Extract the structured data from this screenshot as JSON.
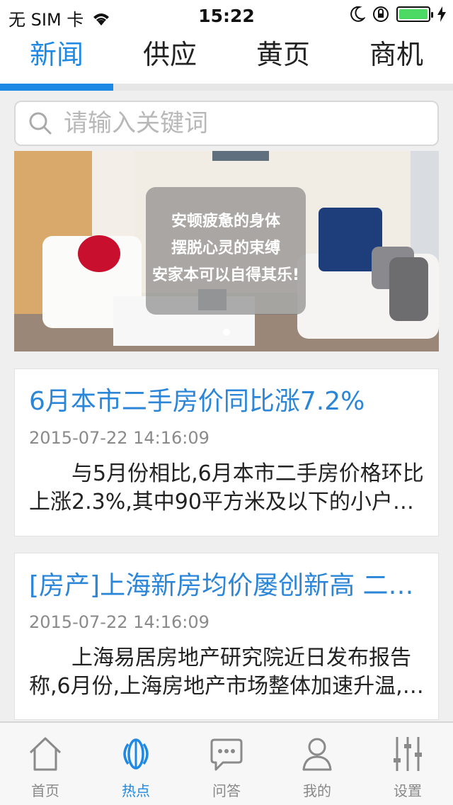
{
  "status": {
    "carrier": "无 SIM 卡",
    "time": "15:22",
    "battery_level": 1.0
  },
  "tabs": [
    {
      "label": "新闻",
      "active": true
    },
    {
      "label": "供应",
      "active": false
    },
    {
      "label": "黄页",
      "active": false
    },
    {
      "label": "商机",
      "active": false
    }
  ],
  "search": {
    "placeholder": "请输入关键词",
    "icon": "search-icon"
  },
  "banner": {
    "caption_lines": [
      "安顿疲惫的身体",
      "摆脱心灵的束缚",
      "安家本可以自得其乐!"
    ],
    "slide_count": 1,
    "active_slide": 1
  },
  "news": [
    {
      "title": "6月本市二手房价同比涨7.2%",
      "time": "2015-07-22 14:16:09",
      "summary": "与5月份相比,6月本市二手房价格环比上涨2.3%,其中90平方米及以下的小户…"
    },
    {
      "title": "[房产]上海新房均价屡创新高 二…",
      "time": "2015-07-22 14:16:09",
      "summary": "上海易居房地产研究院近日发布报告称,6月份,上海房地产市场整体加速升温,…"
    }
  ],
  "bottom_nav": [
    {
      "label": "首页",
      "icon": "home-icon",
      "active": false
    },
    {
      "label": "热点",
      "icon": "hotspot-icon",
      "active": true
    },
    {
      "label": "问答",
      "icon": "chat-icon",
      "active": false
    },
    {
      "label": "我的",
      "icon": "user-icon",
      "active": false
    },
    {
      "label": "设置",
      "icon": "settings-sliders-icon",
      "active": false
    }
  ],
  "colors": {
    "accent": "#1e88e5",
    "title_blue": "#2b86d8",
    "background": "#efeff0"
  }
}
